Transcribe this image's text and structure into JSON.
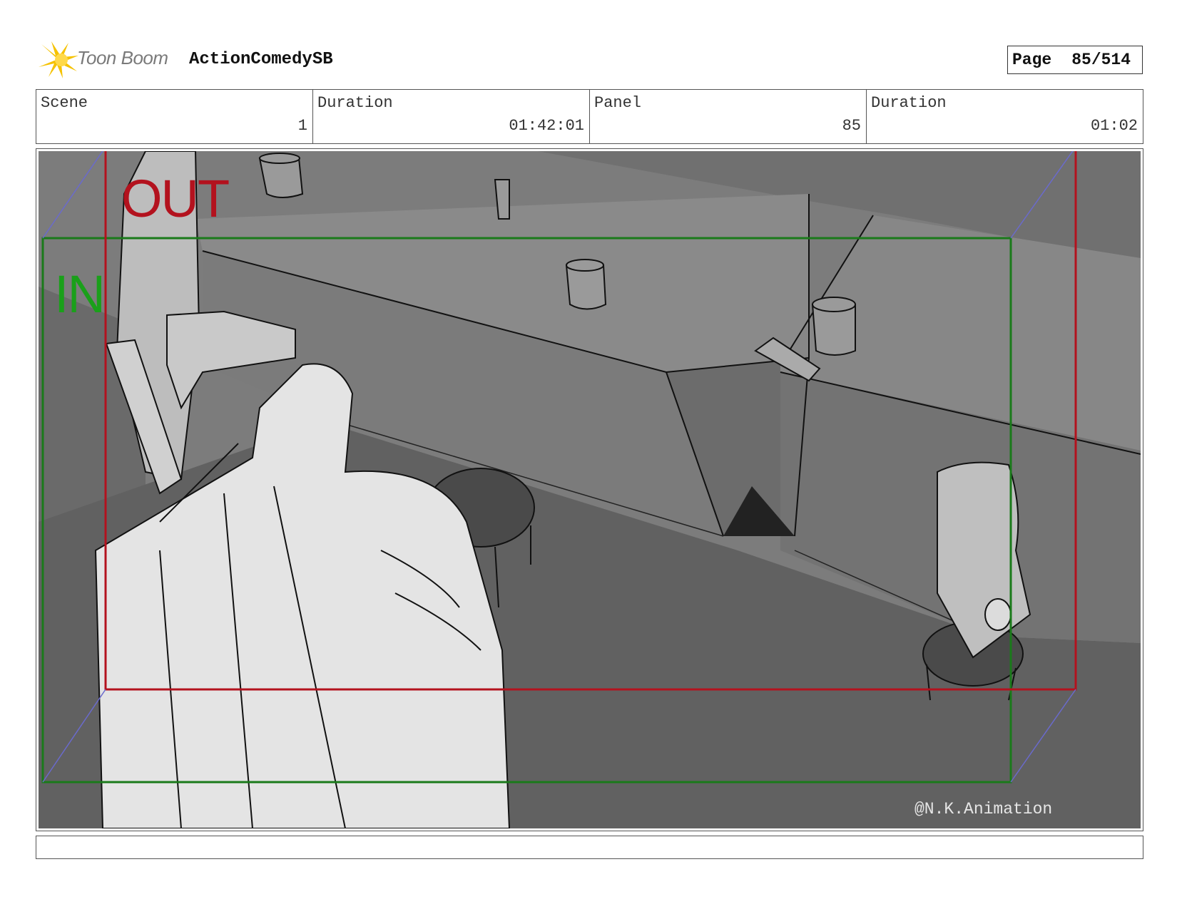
{
  "header": {
    "logo_text": "Toon Boom",
    "project_title": "ActionComedySB",
    "page_label": "Page",
    "page_value": "85/514"
  },
  "info": {
    "scene_label": "Scene",
    "scene_value": "1",
    "scene_duration_label": "Duration",
    "scene_duration_value": "01:42:01",
    "panel_label": "Panel",
    "panel_value": "85",
    "panel_duration_label": "Duration",
    "panel_duration_value": "01:02"
  },
  "panel": {
    "out_label": "OUT",
    "in_label": "IN",
    "watermark": "@N.K.Animation",
    "colors": {
      "out_frame": "#b3121e",
      "in_frame": "#1aa01a",
      "background": "#7a7a7a",
      "floor": "#616161"
    }
  },
  "caption": {
    "text": ""
  }
}
